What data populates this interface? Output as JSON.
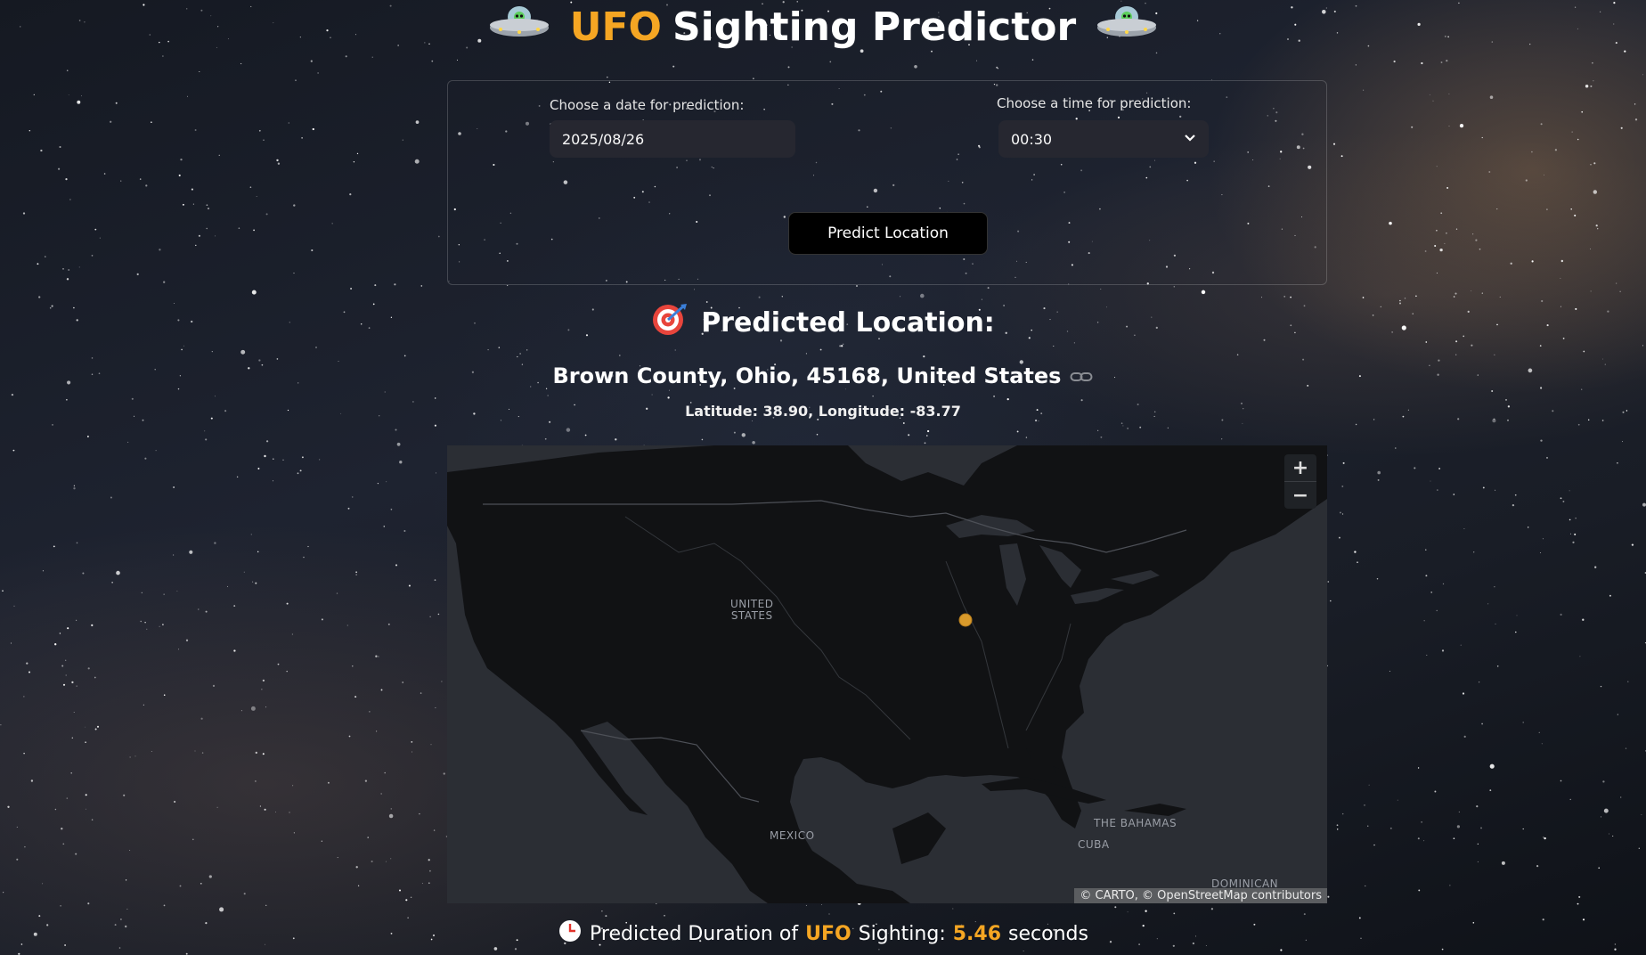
{
  "header": {
    "icon_left": "ufo-icon",
    "title_accent": "UFO",
    "title_rest": "Sighting Predictor",
    "icon_right": "ufo-icon",
    "accent_color": "#f5a623"
  },
  "form": {
    "date_label": "Choose a date for prediction:",
    "date_value": "2025/08/26",
    "time_label": "Choose a time for prediction:",
    "time_value": "00:30",
    "predict_button": "Predict Location"
  },
  "result": {
    "heading_icon": "target-icon",
    "heading": "Predicted Location:",
    "location_name": "Brown County, Ohio, 45168, United States",
    "coords": "Latitude: 38.90, Longitude: -83.77"
  },
  "map": {
    "zoom_in": "+",
    "zoom_out": "−",
    "labels": {
      "united_states": "UNITED\nSTATES",
      "mexico": "MEXICO",
      "bahamas": "THE BAHAMAS",
      "cuba": "CUBA",
      "dominican": "DOMINICAN"
    },
    "attribution": "© CARTO, © OpenStreetMap contributors",
    "marker_color": "#d99a2b"
  },
  "duration": {
    "prefix": "Predicted Duration of",
    "ufo": "UFO",
    "middle": "Sighting:",
    "value": "5.46",
    "unit": "seconds"
  }
}
